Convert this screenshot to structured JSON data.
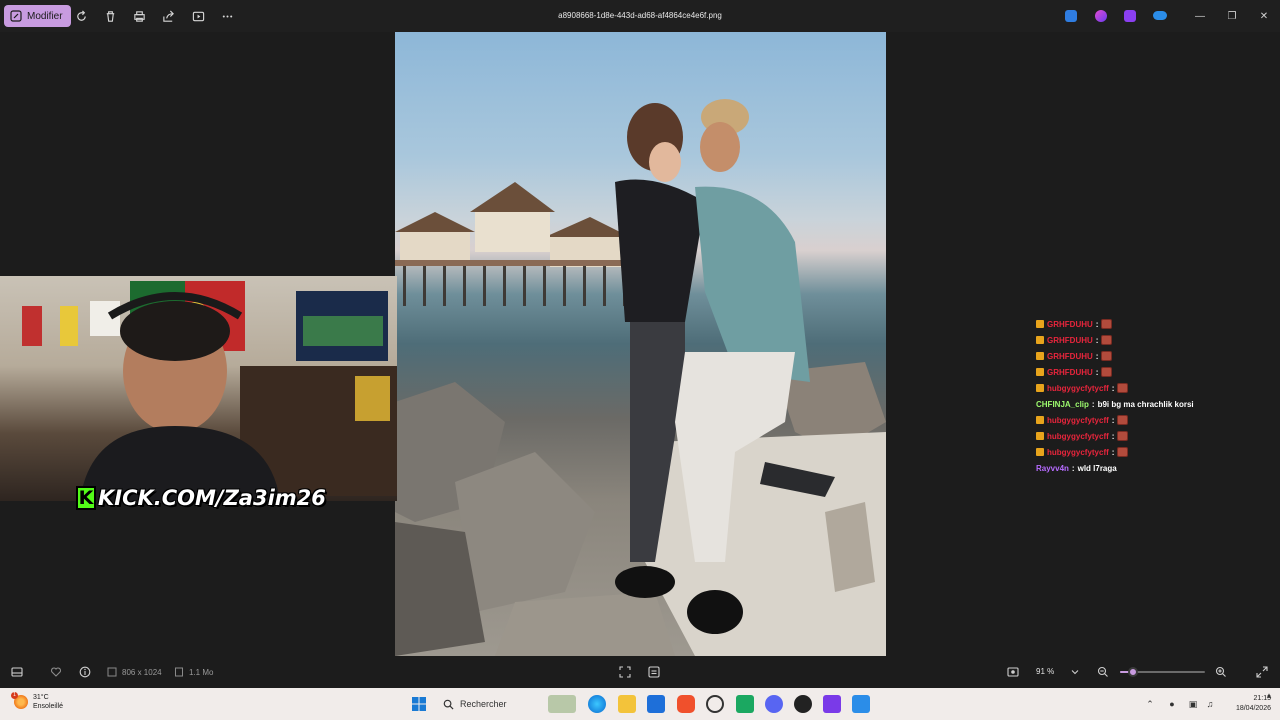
{
  "toolbar": {
    "edit_label": "Modifier",
    "file_name": "a8908668-1d8e-443d-ad68-af4864ce4e6f.png"
  },
  "chat": {
    "messages": [
      {
        "user": "GRHFDUHU",
        "sep": " :",
        "emote": true,
        "text": "",
        "color": "#e8253c"
      },
      {
        "user": "GRHFDUHU",
        "sep": " :",
        "emote": true,
        "text": "",
        "color": "#e8253c"
      },
      {
        "user": "GRHFDUHU",
        "sep": " :",
        "emote": true,
        "text": "",
        "color": "#e8253c"
      },
      {
        "user": "GRHFDUHU",
        "sep": " :",
        "emote": true,
        "text": "",
        "color": "#e8253c"
      },
      {
        "user": "hubgygycfytycff",
        "sep": " :",
        "emote": true,
        "text": "",
        "color": "#e8253c"
      },
      {
        "user": "CHFINJA_clip",
        "sep": " :",
        "emote": false,
        "text": " b9i bg ma chrachlik korsi",
        "color": "#9dfb6e"
      },
      {
        "user": "hubgygycfytycff",
        "sep": " :",
        "emote": true,
        "text": "",
        "color": "#e8253c"
      },
      {
        "user": "hubgygycfytycff",
        "sep": " :",
        "emote": true,
        "text": "",
        "color": "#e8253c"
      },
      {
        "user": "hubgygycfytycff",
        "sep": " :",
        "emote": true,
        "text": "",
        "color": "#e8253c"
      },
      {
        "user": "Rayvv4n",
        "sep": " :",
        "emote": false,
        "text": " wld l7raga",
        "color": "#b66bff"
      }
    ]
  },
  "stream": {
    "kick_text": "KICK.COM/Za3im26",
    "kick_color": "#53fc18"
  },
  "info_bar": {
    "dimensions": "806 x 1024",
    "file_size": "1.1 Mo",
    "zoom_label": "91 %",
    "zoom_percent": 0.15
  },
  "taskbar": {
    "weather_temp": "31°C",
    "weather_desc": "Ensoleillé",
    "weather_alert": "1",
    "search_placeholder": "Rechercher",
    "time": "21:15",
    "date": "18/04/2026"
  },
  "colors": {
    "accent": "#c89be0",
    "badge": "#e8a41c"
  }
}
